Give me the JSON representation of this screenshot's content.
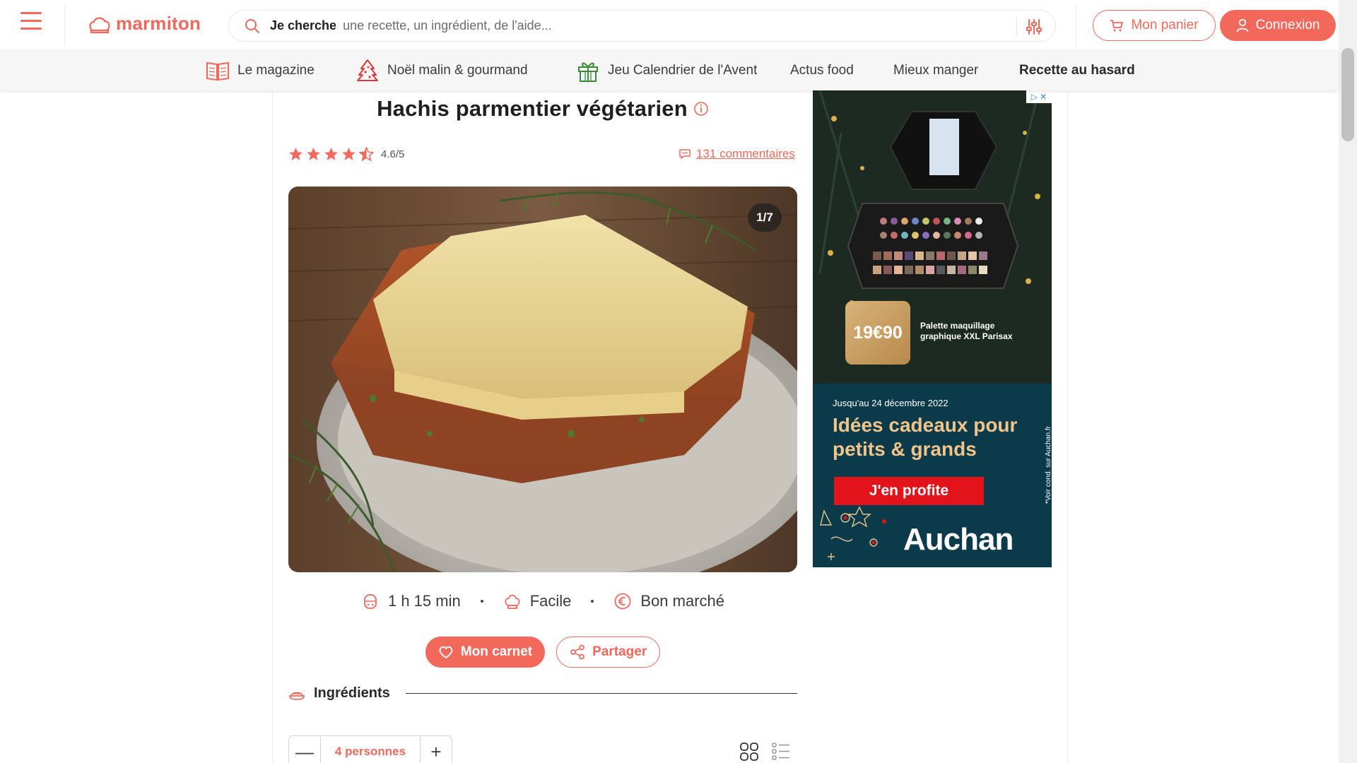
{
  "header": {
    "logo_text": "marmiton",
    "search": {
      "lead": "Je cherche",
      "placeholder": "une recette, un ingrédient, de l'aide..."
    },
    "cart_label": "Mon panier",
    "login_label": "Connexion"
  },
  "nav": {
    "items": [
      {
        "label": "Le magazine",
        "icon": "book-icon"
      },
      {
        "label": "Noël malin & gourmand",
        "icon": "christmas-tree-icon"
      },
      {
        "label": "Jeu Calendrier de l'Avent",
        "icon": "gift-icon"
      },
      {
        "label": "Actus food"
      },
      {
        "label": "Mieux manger"
      },
      {
        "label": "Recette au hasard"
      }
    ]
  },
  "recipe": {
    "title": "Hachis parmentier végétarien",
    "rating": "4.6/5",
    "stars": 4.5,
    "comments": "131 commentaires",
    "image_counter": "1/7",
    "time": "1 h 15 min",
    "difficulty": "Facile",
    "cost": "Bon marché",
    "save_label": "Mon carnet",
    "share_label": "Partager",
    "ingredients_title": "Ingrédients",
    "persons_count": "4",
    "persons_unit": "personnes",
    "minus": "—",
    "plus": "+"
  },
  "ad": {
    "adchoice": "▷ ✕",
    "price": "19€90",
    "product": "Palette maquillage graphique XXL Parisax",
    "date": "Jusqu'au 24 décembre 2022",
    "headline": "Idées cadeaux pour petits & grands",
    "cta": "J'en profite",
    "legal": "*Voir cond. sur Auchan.fr",
    "brand": "Auchan"
  },
  "colors": {
    "accent": "#f2685b",
    "nav_bg": "#f6f6f6",
    "ad_blue": "#0b3a4a",
    "ad_red": "#e2141b"
  }
}
